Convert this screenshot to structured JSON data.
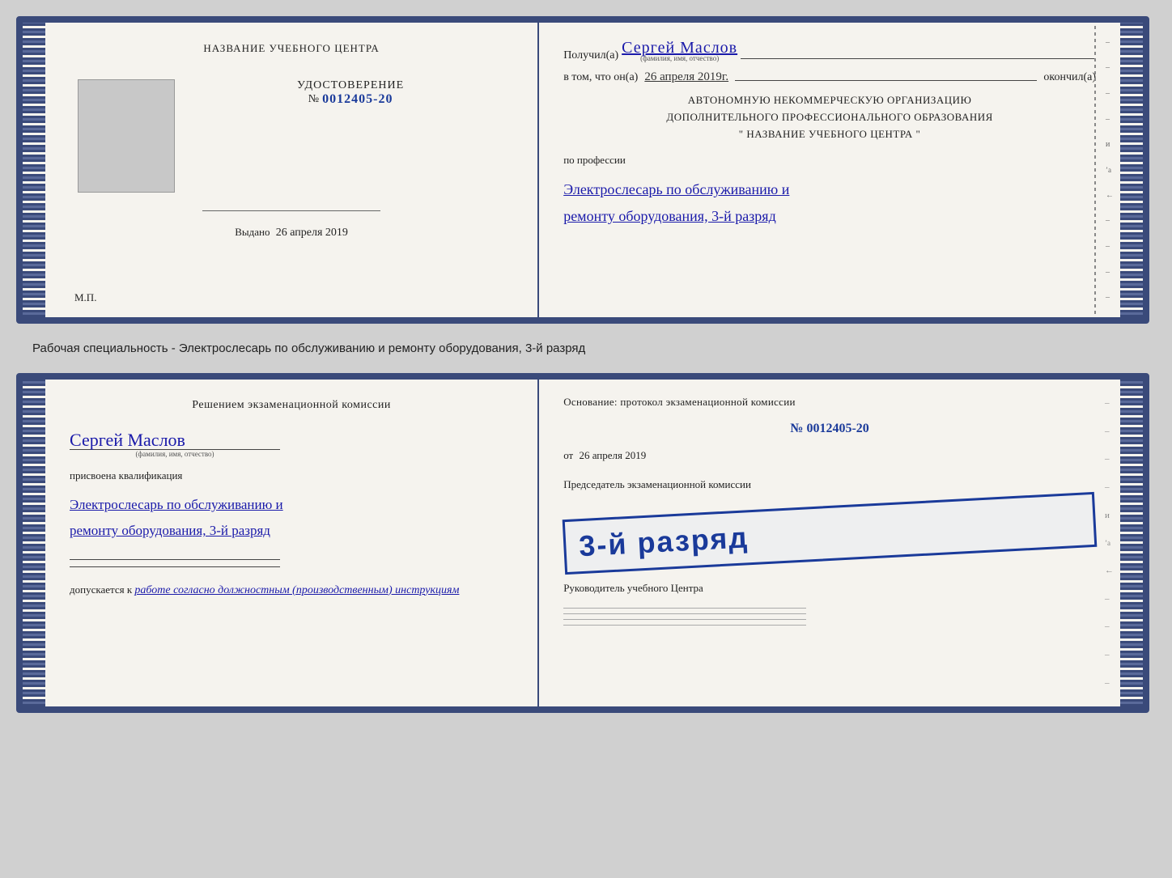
{
  "doc1": {
    "left": {
      "org_name": "НАЗВАНИЕ УЧЕБНОГО ЦЕНТРА",
      "udostoverenie_title": "УДОСТОВЕРЕНИЕ",
      "number_prefix": "№",
      "number": "0012405-20",
      "vydano_label": "Выдано",
      "vydano_date": "26 апреля 2019",
      "mp_label": "М.П."
    },
    "right": {
      "received_label": "Получил(а)",
      "received_name": "Сергей Маслов",
      "fio_subtitle": "(фамилия, имя, отчество)",
      "vtom_label": "в том, что он(а)",
      "vtom_date": "26 апреля 2019г.",
      "okончил_label": "окончил(а)",
      "org_line1": "АВТОНОМНУЮ НЕКОММЕРЧЕСКУЮ ОРГАНИЗАЦИЮ",
      "org_line2": "ДОПОЛНИТЕЛЬНОГО ПРОФЕССИОНАЛЬНОГО ОБРАЗОВАНИЯ",
      "org_line3": "\"   НАЗВАНИЕ УЧЕБНОГО ЦЕНТРА   \"",
      "po_professii": "по профессии",
      "profession_line1": "Электрослесарь по обслуживанию и",
      "profession_line2": "ремонту оборудования, 3-й разряд"
    }
  },
  "specialty_label": "Рабочая специальность - Электрослесарь по обслуживанию и ремонту оборудования, 3-й разряд",
  "doc2": {
    "left": {
      "resheniem_title": "Решением экзаменационной комиссии",
      "person_name": "Сергей Маслов",
      "fio_subtitle": "(фамилия, имя, отчество)",
      "prisvoena": "присвоена квалификация",
      "kvali_line1": "Электрослесарь по обслуживанию и",
      "kvali_line2": "ремонту оборудования, 3-й разряд",
      "dopuskaetsya_label": "допускается к",
      "dopuskaetsya_text": "работе согласно должностным (производственным) инструкциям"
    },
    "right": {
      "osnovanie": "Основание: протокол экзаменационной комиссии",
      "number_prefix": "№",
      "number": "0012405-20",
      "ot_label": "от",
      "date": "26 апреля 2019",
      "predsedatel_label": "Председатель экзаменационной комиссии",
      "stamp_text": "3-й разряд",
      "rukovoditel_label": "Руководитель учебного Центра"
    }
  }
}
